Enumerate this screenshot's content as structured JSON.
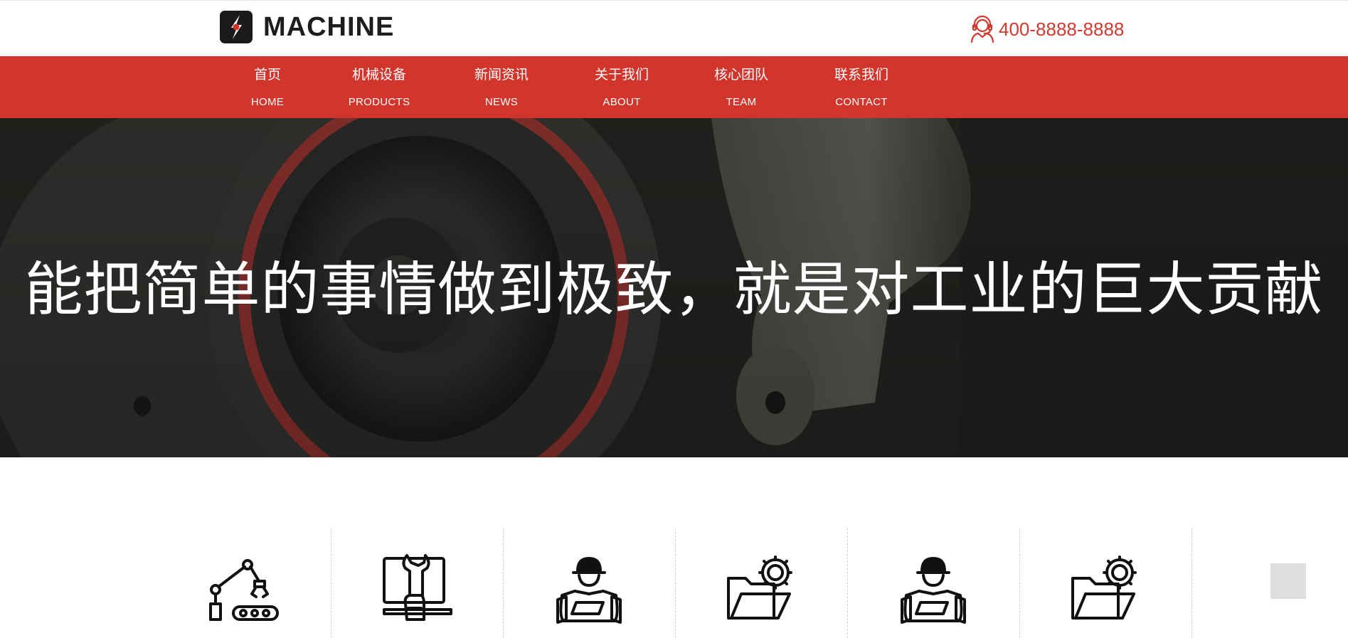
{
  "brand": {
    "name": "MACHINE",
    "accent_color": "#d1352b"
  },
  "header": {
    "phone": "400-8888-8888",
    "phone_icon": "customer-service-headset-icon"
  },
  "nav": {
    "items": [
      {
        "cn": "首页",
        "en": "HOME"
      },
      {
        "cn": "机械设备",
        "en": "PRODUCTS"
      },
      {
        "cn": "新闻资讯",
        "en": "NEWS"
      },
      {
        "cn": "关于我们",
        "en": "ABOUT"
      },
      {
        "cn": "核心团队",
        "en": "TEAM"
      },
      {
        "cn": "联系我们",
        "en": "CONTACT"
      }
    ]
  },
  "banner": {
    "title": "能把简单的事情做到极致，就是对工业的巨大贡献"
  },
  "features": {
    "icons": [
      "robotic-arm-conveyor-icon",
      "monitor-wrench-icon",
      "engineer-blueprint-icon",
      "folder-gear-icon",
      "engineer-blueprint-icon",
      "folder-gear-icon"
    ]
  },
  "back_to_top": {
    "icon": "back-to-top-icon"
  }
}
